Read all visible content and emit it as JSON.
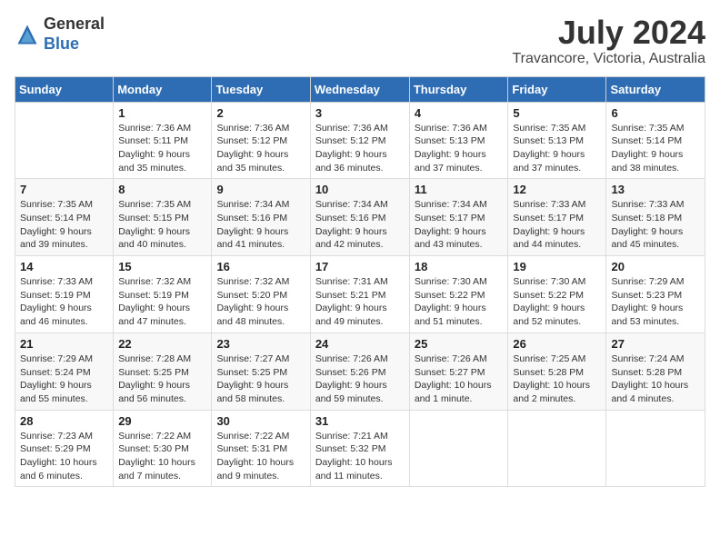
{
  "header": {
    "logo_general": "General",
    "logo_blue": "Blue",
    "month_year": "July 2024",
    "location": "Travancore, Victoria, Australia"
  },
  "days_of_week": [
    "Sunday",
    "Monday",
    "Tuesday",
    "Wednesday",
    "Thursday",
    "Friday",
    "Saturday"
  ],
  "weeks": [
    [
      {
        "day": "",
        "info": ""
      },
      {
        "day": "1",
        "info": "Sunrise: 7:36 AM\nSunset: 5:11 PM\nDaylight: 9 hours\nand 35 minutes."
      },
      {
        "day": "2",
        "info": "Sunrise: 7:36 AM\nSunset: 5:12 PM\nDaylight: 9 hours\nand 35 minutes."
      },
      {
        "day": "3",
        "info": "Sunrise: 7:36 AM\nSunset: 5:12 PM\nDaylight: 9 hours\nand 36 minutes."
      },
      {
        "day": "4",
        "info": "Sunrise: 7:36 AM\nSunset: 5:13 PM\nDaylight: 9 hours\nand 37 minutes."
      },
      {
        "day": "5",
        "info": "Sunrise: 7:35 AM\nSunset: 5:13 PM\nDaylight: 9 hours\nand 37 minutes."
      },
      {
        "day": "6",
        "info": "Sunrise: 7:35 AM\nSunset: 5:14 PM\nDaylight: 9 hours\nand 38 minutes."
      }
    ],
    [
      {
        "day": "7",
        "info": "Sunrise: 7:35 AM\nSunset: 5:14 PM\nDaylight: 9 hours\nand 39 minutes."
      },
      {
        "day": "8",
        "info": "Sunrise: 7:35 AM\nSunset: 5:15 PM\nDaylight: 9 hours\nand 40 minutes."
      },
      {
        "day": "9",
        "info": "Sunrise: 7:34 AM\nSunset: 5:16 PM\nDaylight: 9 hours\nand 41 minutes."
      },
      {
        "day": "10",
        "info": "Sunrise: 7:34 AM\nSunset: 5:16 PM\nDaylight: 9 hours\nand 42 minutes."
      },
      {
        "day": "11",
        "info": "Sunrise: 7:34 AM\nSunset: 5:17 PM\nDaylight: 9 hours\nand 43 minutes."
      },
      {
        "day": "12",
        "info": "Sunrise: 7:33 AM\nSunset: 5:17 PM\nDaylight: 9 hours\nand 44 minutes."
      },
      {
        "day": "13",
        "info": "Sunrise: 7:33 AM\nSunset: 5:18 PM\nDaylight: 9 hours\nand 45 minutes."
      }
    ],
    [
      {
        "day": "14",
        "info": "Sunrise: 7:33 AM\nSunset: 5:19 PM\nDaylight: 9 hours\nand 46 minutes."
      },
      {
        "day": "15",
        "info": "Sunrise: 7:32 AM\nSunset: 5:19 PM\nDaylight: 9 hours\nand 47 minutes."
      },
      {
        "day": "16",
        "info": "Sunrise: 7:32 AM\nSunset: 5:20 PM\nDaylight: 9 hours\nand 48 minutes."
      },
      {
        "day": "17",
        "info": "Sunrise: 7:31 AM\nSunset: 5:21 PM\nDaylight: 9 hours\nand 49 minutes."
      },
      {
        "day": "18",
        "info": "Sunrise: 7:30 AM\nSunset: 5:22 PM\nDaylight: 9 hours\nand 51 minutes."
      },
      {
        "day": "19",
        "info": "Sunrise: 7:30 AM\nSunset: 5:22 PM\nDaylight: 9 hours\nand 52 minutes."
      },
      {
        "day": "20",
        "info": "Sunrise: 7:29 AM\nSunset: 5:23 PM\nDaylight: 9 hours\nand 53 minutes."
      }
    ],
    [
      {
        "day": "21",
        "info": "Sunrise: 7:29 AM\nSunset: 5:24 PM\nDaylight: 9 hours\nand 55 minutes."
      },
      {
        "day": "22",
        "info": "Sunrise: 7:28 AM\nSunset: 5:25 PM\nDaylight: 9 hours\nand 56 minutes."
      },
      {
        "day": "23",
        "info": "Sunrise: 7:27 AM\nSunset: 5:25 PM\nDaylight: 9 hours\nand 58 minutes."
      },
      {
        "day": "24",
        "info": "Sunrise: 7:26 AM\nSunset: 5:26 PM\nDaylight: 9 hours\nand 59 minutes."
      },
      {
        "day": "25",
        "info": "Sunrise: 7:26 AM\nSunset: 5:27 PM\nDaylight: 10 hours\nand 1 minute."
      },
      {
        "day": "26",
        "info": "Sunrise: 7:25 AM\nSunset: 5:28 PM\nDaylight: 10 hours\nand 2 minutes."
      },
      {
        "day": "27",
        "info": "Sunrise: 7:24 AM\nSunset: 5:28 PM\nDaylight: 10 hours\nand 4 minutes."
      }
    ],
    [
      {
        "day": "28",
        "info": "Sunrise: 7:23 AM\nSunset: 5:29 PM\nDaylight: 10 hours\nand 6 minutes."
      },
      {
        "day": "29",
        "info": "Sunrise: 7:22 AM\nSunset: 5:30 PM\nDaylight: 10 hours\nand 7 minutes."
      },
      {
        "day": "30",
        "info": "Sunrise: 7:22 AM\nSunset: 5:31 PM\nDaylight: 10 hours\nand 9 minutes."
      },
      {
        "day": "31",
        "info": "Sunrise: 7:21 AM\nSunset: 5:32 PM\nDaylight: 10 hours\nand 11 minutes."
      },
      {
        "day": "",
        "info": ""
      },
      {
        "day": "",
        "info": ""
      },
      {
        "day": "",
        "info": ""
      }
    ]
  ]
}
